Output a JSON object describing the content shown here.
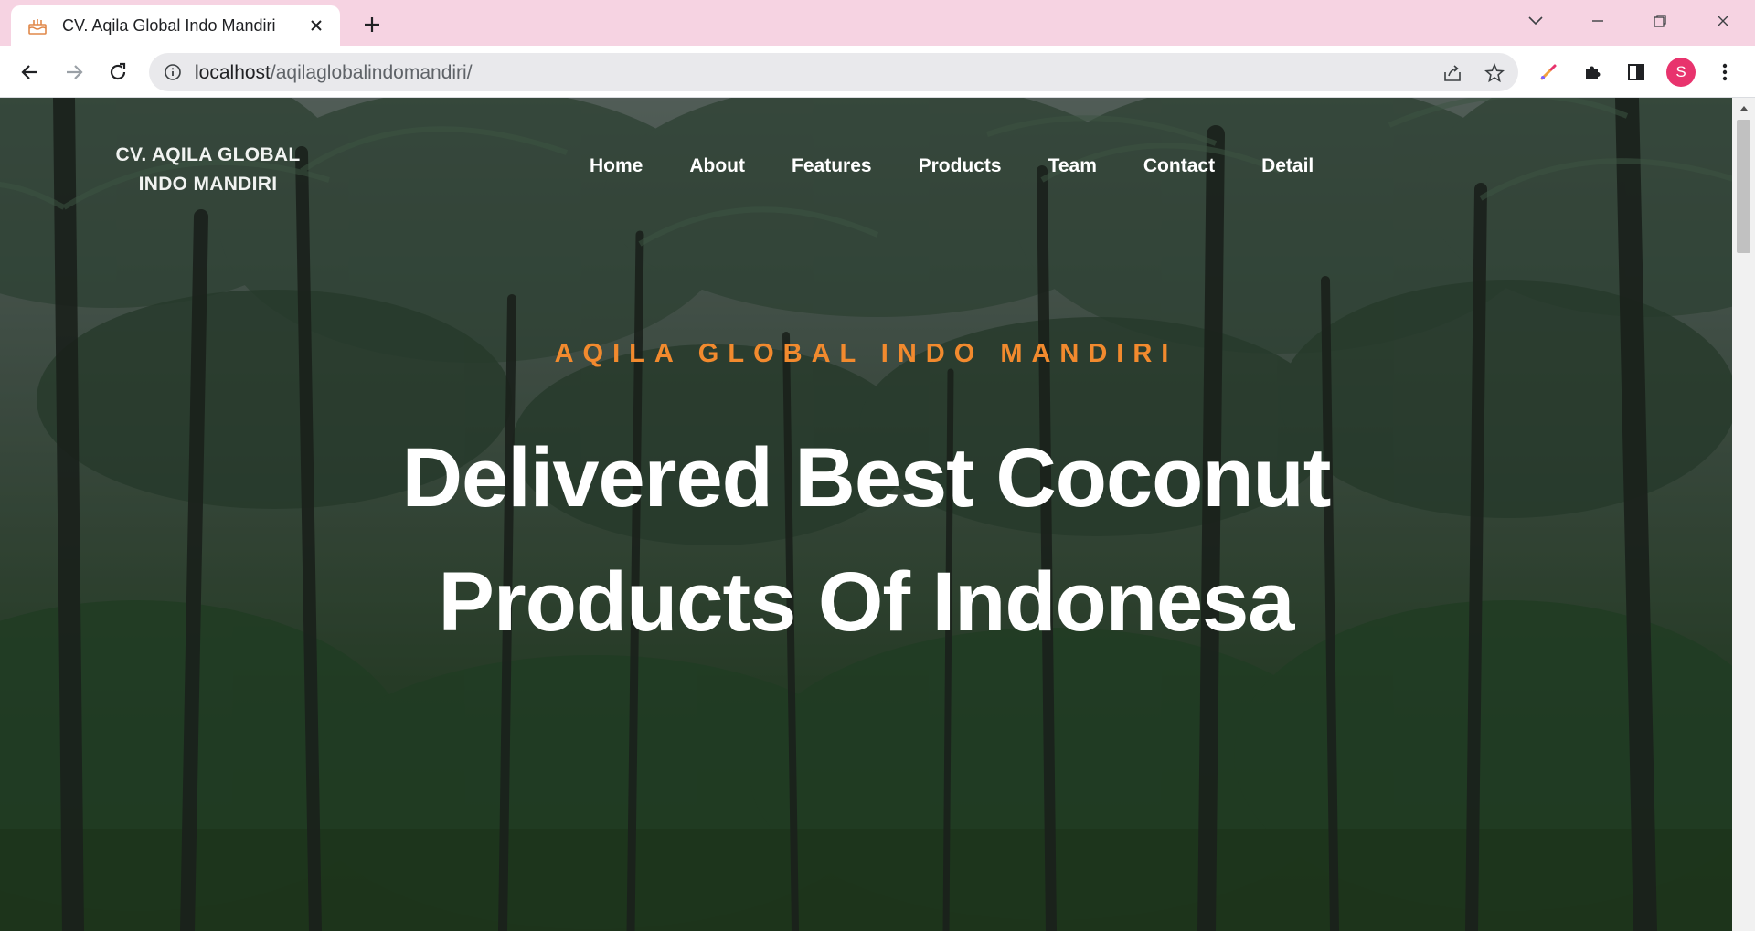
{
  "browser": {
    "tab_title": "CV. Aqila Global Indo Mandiri",
    "url_host": "localhost",
    "url_path": "/aqilaglobalindomandiri/",
    "profile_initial": "S",
    "colors": {
      "tabstrip": "#f6d3e2",
      "avatar": "#e8336d",
      "omnibox": "#e9e9ec"
    },
    "icons": [
      "cake-favicon-icon",
      "close-icon",
      "new-tab-icon",
      "tab-search-icon",
      "minimize-icon",
      "restore-icon",
      "window-close-icon",
      "back-icon",
      "forward-icon",
      "reload-icon",
      "info-icon",
      "share-icon",
      "star-icon",
      "color-picker-extension-icon",
      "puzzle-icon",
      "side-panel-icon",
      "menu-icon"
    ]
  },
  "site": {
    "brand": "CV. AQILA GLOBAL INDO MANDIRI",
    "nav": [
      "Home",
      "About",
      "Features",
      "Products",
      "Team",
      "Contact",
      "Detail"
    ],
    "hero": {
      "eyebrow": "AQILA GLOBAL INDO MANDIRI",
      "headline_line1": "Delivered Best Coconut",
      "headline_line2": "Products Of Indonesa"
    },
    "colors": {
      "eyebrow": "#f28a2e",
      "headline": "#ffffff"
    }
  }
}
